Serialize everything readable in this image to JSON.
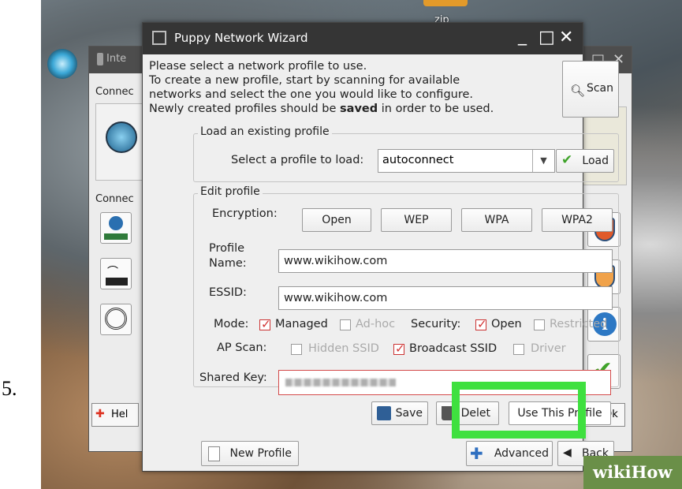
{
  "step_number": "5.",
  "desktop": {
    "zip_label": "zip",
    "watermark": "wikiHow"
  },
  "background_window": {
    "title": "Inte",
    "connect_label_1": "Connec",
    "connect_label_2": "Connec",
    "help_label": "Hel",
    "ok_label": "Ok"
  },
  "dialog": {
    "title": "Puppy Network Wizard",
    "intro_lines": [
      "Please select a network profile to use.",
      "To create a new profile, start by scanning for available",
      "networks and select the one you would like to configure."
    ],
    "intro_last_prefix": "Newly created profiles should be ",
    "intro_last_bold": "saved",
    "intro_last_suffix": " in order to be used.",
    "scan_label": "Scan",
    "load_group": {
      "legend": "Load an existing profile",
      "select_label": "Select a profile to load:",
      "selected_profile": "autoconnect",
      "load_label": "Load"
    },
    "edit_group": {
      "legend": "Edit profile",
      "encryption_label": "Encryption:",
      "encryption_options": [
        "Open",
        "WEP",
        "WPA",
        "WPA2"
      ],
      "profile_name_label_1": "Profile",
      "profile_name_label_2": "Name:",
      "profile_name_value": "www.wikihow.com",
      "essid_label": "ESSID:",
      "essid_value": "www.wikihow.com",
      "mode_label": "Mode:",
      "mode_managed": "Managed",
      "mode_adhoc": "Ad-hoc",
      "security_label": "Security:",
      "security_open": "Open",
      "security_restricted": "Restricted",
      "ap_scan_label": "AP Scan:",
      "hidden_ssid": "Hidden SSID",
      "broadcast_ssid": "Broadcast SSID",
      "driver": "Driver",
      "shared_key_label": "Shared Key:",
      "save_label": "Save",
      "delete_label": "Delet",
      "use_profile_label": "Use This Profile"
    },
    "footer": {
      "new_profile_label": "New Profile",
      "advanced_label": "Advanced",
      "back_label": "Back"
    }
  },
  "colors": {
    "highlight": "#3fe03f",
    "checkmark": "#d23232",
    "load_check": "#3fa32a"
  }
}
